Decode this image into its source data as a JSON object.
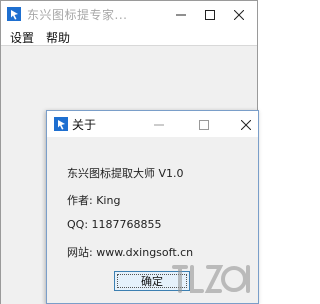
{
  "main_window": {
    "title": "东兴图标提专家...",
    "menu": [
      {
        "label": "设置"
      },
      {
        "label": "帮助"
      }
    ]
  },
  "about_dialog": {
    "title": "关于",
    "lines": [
      "东兴图标提取大师 V1.0",
      "作者: King",
      "QQ: 1187768855",
      "网站: www.dxingsoft.cn"
    ],
    "ok_label": "确定"
  },
  "colors": {
    "accent": "#0078d7",
    "dialog_border": "#7a9ec9",
    "button_border": "#3c7fb1"
  },
  "icons": [
    "app-icon",
    "minimize-icon",
    "maximize-icon",
    "close-icon",
    "watermark-logo"
  ]
}
